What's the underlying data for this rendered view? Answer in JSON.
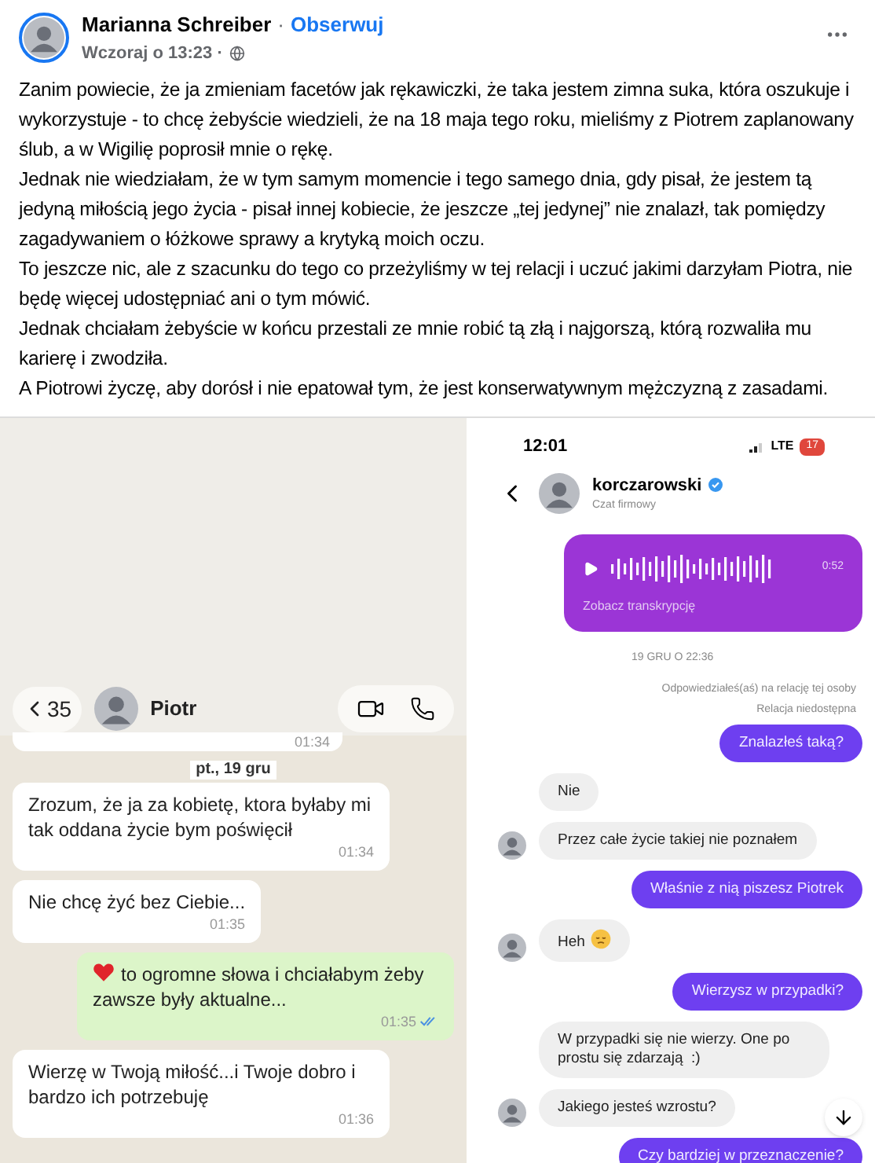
{
  "post": {
    "author": "Marianna Schreiber",
    "separator": "·",
    "follow": "Obserwuj",
    "time": "Wczoraj o 13:23 ·",
    "paragraphs": [
      "Zanim powiecie, że ja zmieniam facetów jak rękawiczki, że taka jestem zimna suka, która oszukuje i wykorzystuje - to chcę żebyście wiedzieli, że na 18 maja tego roku, mieliśmy z Piotrem zaplanowany ślub, a w Wigilię poprosił mnie o rękę.",
      "Jednak nie wiedziałam, że w tym samym momencie i tego samego dnia, gdy pisał, że jestem tą jedyną miłością jego życia - pisał innej kobiecie, że jeszcze „tej jedynej” nie znalazł, tak pomiędzy zagadywaniem o łóżkowe sprawy a krytyką moich oczu.",
      "To jeszcze nic, ale z szacunku do tego co przeżyliśmy w tej relacji i uczuć jakimi darzyłam Piotra, nie będę więcej udostępniać ani o tym mówić.",
      "Jednak chciałam żebyście w końcu przestali ze mnie robić tą złą i najgorszą, którą rozwaliła mu karierę i zwodziła.",
      "A Piotrowi życzę, aby dorósł i nie epatował tym, że jest konserwatywnym mężczyzną z zasadami."
    ]
  },
  "chat_left": {
    "back_count": "35",
    "contact": "Piotr",
    "cut_time": "01:34",
    "date": "pt., 19 gru",
    "messages": [
      {
        "kind": "in",
        "text": "Zrozum, że ja za kobietę, ktora byłaby mi tak oddana życie bym poświęcił",
        "time": "01:34"
      },
      {
        "kind": "in",
        "text": "Nie chcę żyć bez Ciebie...",
        "time": "01:35"
      },
      {
        "kind": "heart",
        "text": "to ogromne słowa i chciałabym żeby zawsze były aktualne...",
        "time": "01:35",
        "read": true
      },
      {
        "kind": "in",
        "text": "Wierzę w Twoją miłość...i Twoje dobro i bardzo ich potrzebuję",
        "time": "01:36"
      }
    ]
  },
  "chat_right": {
    "clock": "12:01",
    "network": "LTE",
    "battery": "17",
    "username": "korczarowski",
    "verified": true,
    "subtitle": "Czat firmowy",
    "voice": {
      "duration": "0:52",
      "link": "Zobacz transkrypcję"
    },
    "date": "19 GRU O 22:36",
    "reply_note": "Odpowiedziałeś(aś) na relację tej osoby",
    "story_status": "Relacja niedostępna",
    "messages": [
      {
        "kind": "out",
        "text": "Znalazłeś taką?"
      },
      {
        "kind": "in",
        "text": "Nie",
        "avatar": false
      },
      {
        "kind": "in",
        "text": "Przez całe życie takiej nie poznałem",
        "avatar": true
      },
      {
        "kind": "out",
        "text": "Właśnie z nią piszesz Piotrek"
      },
      {
        "kind": "smiley",
        "text": "Heh",
        "avatar": true
      },
      {
        "kind": "out",
        "text": "Wierzysz w przypadki?"
      },
      {
        "kind": "in",
        "text": "W przypadki się nie wierzy. One po prostu się zdarzają  :)",
        "avatar": false
      },
      {
        "kind": "in",
        "text": "Jakiego jesteś wzrostu?",
        "avatar": true
      },
      {
        "kind": "out",
        "text": "Czy bardziej w przeznaczenie?"
      }
    ]
  }
}
